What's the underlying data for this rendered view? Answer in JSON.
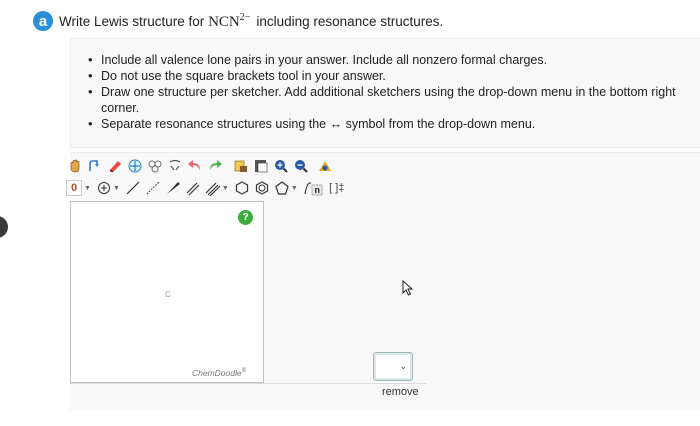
{
  "question": {
    "part_label": "a",
    "text_before": "Write Lewis structure for",
    "formula_base": "NCN",
    "formula_charge": "2−",
    "text_after": "including resonance structures."
  },
  "instructions": [
    "Include all valence lone pairs in your answer. Include all nonzero formal charges.",
    "Do not use the square brackets tool in your answer.",
    "Draw one structure per sketcher. Add additional sketchers using the drop-down menu in the bottom right corner.",
    "Separate resonance structures using the ↔ symbol from the drop-down menu."
  ],
  "toolbar": {
    "charge_label": "0",
    "brackets_label": "[ ]‡",
    "atom_label": "n"
  },
  "canvas": {
    "atom_label": "C",
    "brand": "ChemDoodle",
    "brand_mark": "®",
    "help_label": "?"
  },
  "sketcher_menu": {
    "chevron": "⌄"
  },
  "remove_label": "remove",
  "colors": {
    "badge": "#2a8fd6",
    "help": "#3faa3f",
    "panel_bg": "#f7f8f7",
    "select_border": "#9db9b7"
  }
}
